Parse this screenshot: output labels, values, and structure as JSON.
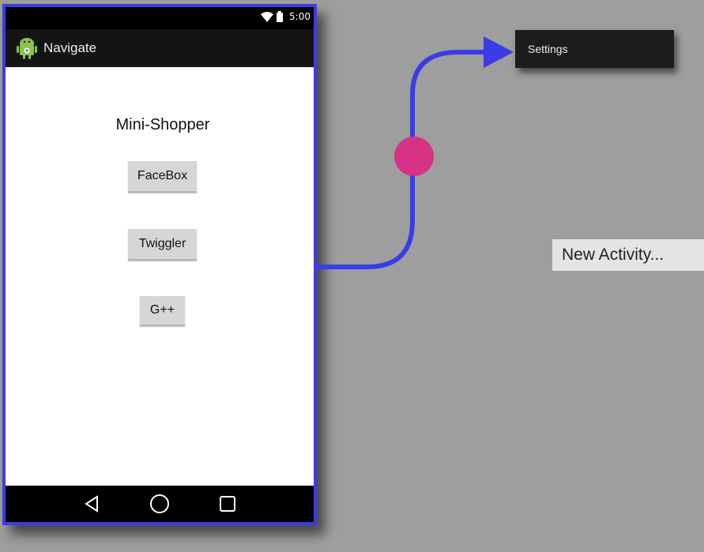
{
  "status_bar": {
    "time": "5:00",
    "wifi_icon": "wifi-icon",
    "battery_icon": "battery-icon"
  },
  "action_bar": {
    "app_icon": "android-icon",
    "title": "Navigate"
  },
  "screen": {
    "title": "Mini-Shopper",
    "buttons": [
      {
        "label": "FaceBox"
      },
      {
        "label": "Twiggler"
      },
      {
        "label": "G++"
      }
    ]
  },
  "nav_bar": {
    "icons": [
      "back-icon",
      "home-icon",
      "recents-icon"
    ]
  },
  "connector": {
    "color": "#3b3be8",
    "dot_color": "#d63384"
  },
  "settings_menu": {
    "item": "Settings"
  },
  "new_activity": {
    "label": "New Activity..."
  }
}
